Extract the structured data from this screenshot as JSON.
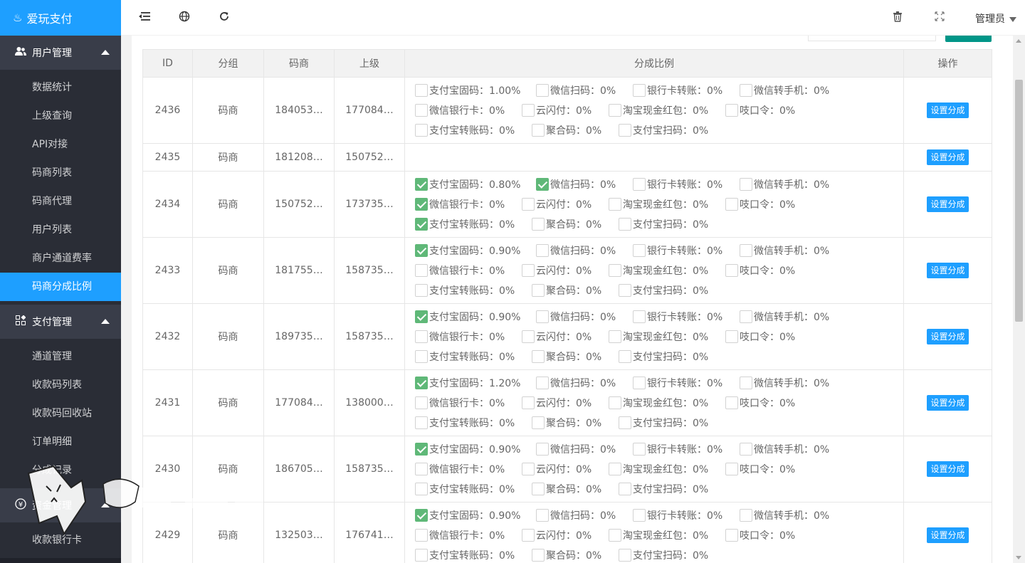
{
  "app": {
    "title": "爱玩支付"
  },
  "sidebar": {
    "groups": [
      {
        "label": "用户管理",
        "icon": "users-icon",
        "items": [
          "数据统计",
          "上级查询",
          "API对接",
          "码商列表",
          "码商代理",
          "用户列表",
          "商户通道费率",
          "码商分成比例"
        ]
      },
      {
        "label": "支付管理",
        "icon": "apps-icon",
        "items": [
          "通道管理",
          "收款码列表",
          "收款码回收站",
          "订单明细",
          "分成记录"
        ]
      },
      {
        "label": "资金管理",
        "icon": "yen-icon",
        "items": [
          "收款银行卡"
        ]
      }
    ],
    "active_item": "码商分成比例"
  },
  "header": {
    "icons": [
      "menu-fold-icon",
      "globe-icon",
      "refresh-icon",
      "trash-icon",
      "fullscreen-icon"
    ],
    "user": "管理员"
  },
  "table": {
    "columns": [
      "ID",
      "分组",
      "码商",
      "上级",
      "分成比例",
      "操作"
    ],
    "action_label": "设置分成",
    "rows": [
      {
        "id": "2436",
        "group": "码商",
        "merchant": "184053…",
        "parent": "177084…",
        "ratios": [
          [
            0,
            "支付宝固码：1.00%"
          ],
          [
            0,
            "微信扫码：0%"
          ],
          [
            0,
            "银行卡转账：0%"
          ],
          [
            0,
            "微信转手机：0%"
          ],
          [
            0,
            "微信银行卡：0%"
          ],
          [
            0,
            "云闪付：0%"
          ],
          [
            0,
            "淘宝现金红包：0%"
          ],
          [
            0,
            "吱口令：0%"
          ],
          [
            0,
            "支付宝转账码：0%"
          ],
          [
            0,
            "聚合码：0%"
          ],
          [
            0,
            "支付宝扫码：0%"
          ]
        ]
      },
      {
        "id": "2435",
        "group": "码商",
        "merchant": "181208…",
        "parent": "150752…",
        "ratios": []
      },
      {
        "id": "2434",
        "group": "码商",
        "merchant": "150752…",
        "parent": "173735…",
        "ratios": [
          [
            1,
            "支付宝固码：0.80%"
          ],
          [
            1,
            "微信扫码：0%"
          ],
          [
            0,
            "银行卡转账：0%"
          ],
          [
            0,
            "微信转手机：0%"
          ],
          [
            1,
            "微信银行卡：0%"
          ],
          [
            0,
            "云闪付：0%"
          ],
          [
            0,
            "淘宝现金红包：0%"
          ],
          [
            0,
            "吱口令：0%"
          ],
          [
            1,
            "支付宝转账码：0%"
          ],
          [
            0,
            "聚合码：0%"
          ],
          [
            0,
            "支付宝扫码：0%"
          ]
        ]
      },
      {
        "id": "2433",
        "group": "码商",
        "merchant": "181755…",
        "parent": "158735…",
        "ratios": [
          [
            1,
            "支付宝固码：0.90%"
          ],
          [
            0,
            "微信扫码：0%"
          ],
          [
            0,
            "银行卡转账：0%"
          ],
          [
            0,
            "微信转手机：0%"
          ],
          [
            0,
            "微信银行卡：0%"
          ],
          [
            0,
            "云闪付：0%"
          ],
          [
            0,
            "淘宝现金红包：0%"
          ],
          [
            0,
            "吱口令：0%"
          ],
          [
            0,
            "支付宝转账码：0%"
          ],
          [
            0,
            "聚合码：0%"
          ],
          [
            0,
            "支付宝扫码：0%"
          ]
        ]
      },
      {
        "id": "2432",
        "group": "码商",
        "merchant": "189735…",
        "parent": "158735…",
        "ratios": [
          [
            1,
            "支付宝固码：0.90%"
          ],
          [
            0,
            "微信扫码：0%"
          ],
          [
            0,
            "银行卡转账：0%"
          ],
          [
            0,
            "微信转手机：0%"
          ],
          [
            0,
            "微信银行卡：0%"
          ],
          [
            0,
            "云闪付：0%"
          ],
          [
            0,
            "淘宝现金红包：0%"
          ],
          [
            0,
            "吱口令：0%"
          ],
          [
            0,
            "支付宝转账码：0%"
          ],
          [
            0,
            "聚合码：0%"
          ],
          [
            0,
            "支付宝扫码：0%"
          ]
        ]
      },
      {
        "id": "2431",
        "group": "码商",
        "merchant": "177084…",
        "parent": "138000…",
        "ratios": [
          [
            1,
            "支付宝固码：1.20%"
          ],
          [
            0,
            "微信扫码：0%"
          ],
          [
            0,
            "银行卡转账：0%"
          ],
          [
            0,
            "微信转手机：0%"
          ],
          [
            0,
            "微信银行卡：0%"
          ],
          [
            0,
            "云闪付：0%"
          ],
          [
            0,
            "淘宝现金红包：0%"
          ],
          [
            0,
            "吱口令：0%"
          ],
          [
            0,
            "支付宝转账码：0%"
          ],
          [
            0,
            "聚合码：0%"
          ],
          [
            0,
            "支付宝扫码：0%"
          ]
        ]
      },
      {
        "id": "2430",
        "group": "码商",
        "merchant": "186705…",
        "parent": "158735…",
        "ratios": [
          [
            1,
            "支付宝固码：0.90%"
          ],
          [
            0,
            "微信扫码：0%"
          ],
          [
            0,
            "银行卡转账：0%"
          ],
          [
            0,
            "微信转手机：0%"
          ],
          [
            0,
            "微信银行卡：0%"
          ],
          [
            0,
            "云闪付：0%"
          ],
          [
            0,
            "淘宝现金红包：0%"
          ],
          [
            0,
            "吱口令：0%"
          ],
          [
            0,
            "支付宝转账码：0%"
          ],
          [
            0,
            "聚合码：0%"
          ],
          [
            0,
            "支付宝扫码：0%"
          ]
        ]
      },
      {
        "id": "2429",
        "group": "码商",
        "merchant": "132503…",
        "parent": "176741…",
        "ratios": [
          [
            1,
            "支付宝固码：0.90%"
          ],
          [
            0,
            "微信扫码：0%"
          ],
          [
            0,
            "银行卡转账：0%"
          ],
          [
            0,
            "微信转手机：0%"
          ],
          [
            0,
            "微信银行卡：0%"
          ],
          [
            0,
            "云闪付：0%"
          ],
          [
            0,
            "淘宝现金红包：0%"
          ],
          [
            0,
            "吱口令：0%"
          ],
          [
            0,
            "支付宝转账码：0%"
          ],
          [
            0,
            "聚合码：0%"
          ],
          [
            0,
            "支付宝扫码：0%"
          ]
        ]
      }
    ]
  },
  "colors": {
    "accent": "#1e9fff",
    "checked": "#5fb878",
    "sidebar": "#20222a",
    "search_button": "#009688"
  }
}
